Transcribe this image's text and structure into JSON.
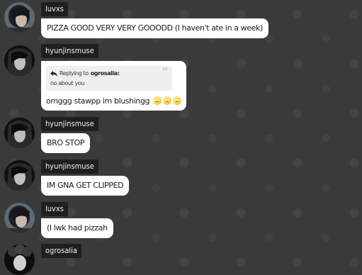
{
  "messages": [
    {
      "username": "luvxs",
      "text": "PIZZA GOOD VERY VERY GOOODD (I haven't ate in a week)",
      "avatar_icon": "avatar-dark-hair-icon"
    },
    {
      "username": "hyunjinsmuse",
      "reply_label": "Replying to",
      "reply_user": "ogrosalia:",
      "reply_text": "no about you",
      "text": "omggg stawpp im blushingg",
      "emoji": "pleading-face-emoji",
      "emoji_count": 3,
      "avatar_icon": "avatar-long-hair-icon"
    },
    {
      "username": "hyunjinsmuse",
      "text": "BRO STOP",
      "avatar_icon": "avatar-long-hair-icon"
    },
    {
      "username": "hyunjinsmuse",
      "text": "IM GNA GET CLIPPED",
      "avatar_icon": "avatar-long-hair-icon"
    },
    {
      "username": "luvxs",
      "text": "(I lwk had pizzah",
      "avatar_icon": "avatar-dark-hair-icon"
    },
    {
      "username": "ogrosalia",
      "avatar_icon": "avatar-curly-hair-icon"
    }
  ]
}
